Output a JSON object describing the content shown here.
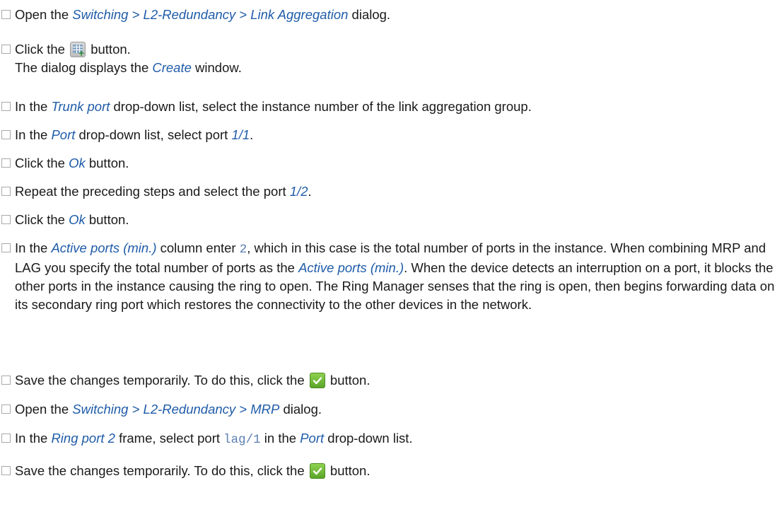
{
  "steps": [
    {
      "a": "Open the ",
      "em1": "Switching > L2-Redundancy > Link Aggregation",
      "b": " dialog."
    },
    {
      "a": "Click the ",
      "icon": "create-table-icon",
      "b": " button.",
      "line2a": "The dialog displays the ",
      "em1": "Create",
      "line2b": " window."
    },
    {
      "a": "In the ",
      "em1": "Trunk port",
      "b": " drop-down list, select the instance number of the link aggregation group."
    },
    {
      "a": "In the ",
      "em1": "Port",
      "b": " drop-down list, select port ",
      "em2": "1/1",
      "c": "."
    },
    {
      "a": "Click the ",
      "em1": "Ok",
      "b": " button."
    },
    {
      "a": "Repeat the preceding steps and select the port ",
      "em1": "1/2",
      "b": "."
    },
    {
      "a": "Click the ",
      "em1": "Ok",
      "b": " button."
    },
    {
      "a": "In the ",
      "em1": "Active ports (min.)",
      "b": " column enter ",
      "code1": "2",
      "c": ", which in this case is the total number of ports in the instance. When combining MRP and LAG you specify the total number of ports as the ",
      "em2": "Active ports (min.)",
      "d": ". When the device detects an interruption on a port, it blocks the other ports in the instance causing the ring to open. The Ring Manager senses that the ring is open, then begins forwarding data on its secondary ring port which restores the connectivity to the other devices in the network."
    },
    {
      "a": "Save the changes temporarily. To do this, click the ",
      "icon": "checkmark-icon",
      "b": " button."
    },
    {
      "a": "Open the ",
      "em1": "Switching > L2-Redundancy > MRP",
      "b": " dialog."
    },
    {
      "a": "In the ",
      "em1": "Ring port 2",
      "b": " frame, select port ",
      "code1": "lag/1",
      "c": " in the ",
      "em2": "Port",
      "d": " drop-down list."
    },
    {
      "a": "Save the changes temporarily. To do this, click the ",
      "icon": "checkmark-icon",
      "b": " button."
    }
  ]
}
